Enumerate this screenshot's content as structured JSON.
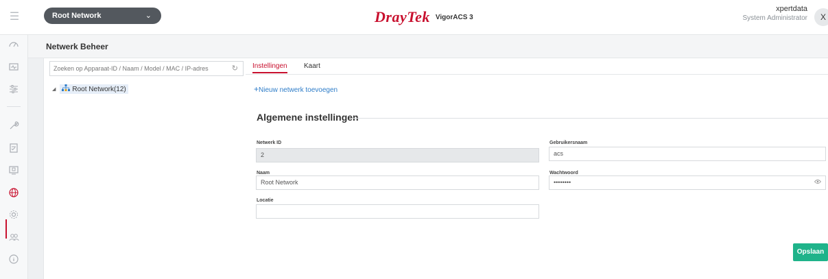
{
  "header": {
    "network_selector": "Root Network",
    "brand": "DrayTek",
    "brand_product": "VigorACS 3",
    "user_name": "xpertdata",
    "user_role": "System Administrator",
    "avatar_initial": "X"
  },
  "page": {
    "title": "Netwerk Beheer"
  },
  "tree": {
    "search_placeholder": "Zoeken op Apparaat-ID / Naam / Model / MAC / IP-adres",
    "root_label": "Root Network(12)"
  },
  "tabs": [
    {
      "label": "Instellingen",
      "active": true
    },
    {
      "label": "Kaart",
      "active": false
    }
  ],
  "add_network_link": "Nieuw netwerk toevoegen",
  "section_title": "Algemene instellingen",
  "form": {
    "network_id_label": "Netwerk ID",
    "network_id_value": "2",
    "name_label": "Naam",
    "name_value": "Root Network",
    "location_label": "Locatie",
    "location_value": "",
    "username_label": "Gebruikersnaam",
    "username_value": "acs",
    "password_label": "Wachtwoord",
    "password_value": "••••••••"
  },
  "save_label": "Opslaan",
  "nav_icons": [
    "dashboard-icon",
    "monitor-icon",
    "sliders-icon",
    "wrench-icon",
    "checklist-icon",
    "device-icon",
    "globe-icon",
    "gear-icon",
    "users-icon",
    "info-icon"
  ],
  "colors": {
    "brand_red": "#c8102e",
    "save_green": "#1fb38a",
    "link_blue": "#2d7cc8"
  }
}
